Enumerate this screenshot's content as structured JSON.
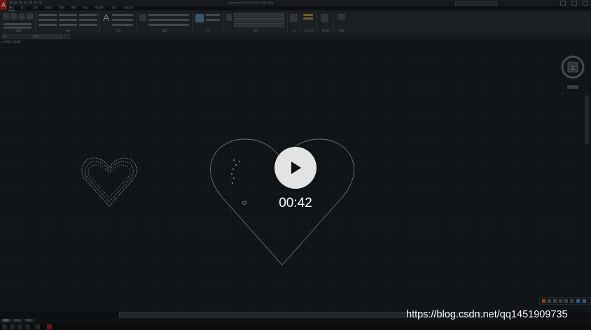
{
  "app": {
    "logo_letter": "A",
    "title": "Autodesk AutoCAD 2019  心形1.dwg"
  },
  "menu_tabs": [
    "默认",
    "插入",
    "注释",
    "参数化",
    "视图",
    "管理",
    "输出",
    "附加模块",
    "协作",
    "精选应用"
  ],
  "ribbon": {
    "groups": [
      "绘图",
      "修改",
      "注释",
      "图层",
      "块",
      "特性",
      "组",
      "实用工具",
      "剪贴板",
      "视图"
    ]
  },
  "file_tabs": [
    "开始",
    "心形1*"
  ],
  "viewport_label": "[-][俯视][二维线框]",
  "viewcube_label": "上",
  "layout_tabs": [
    "模型",
    "布局1",
    "布局2"
  ],
  "video": {
    "duration": "00:42",
    "play_icon": "play-icon"
  },
  "watermark": "https://blog.csdn.net/qq1451909735",
  "colors": {
    "canvas": "#151a1e",
    "ribbon": "#24282c",
    "heart_line": "#8c9298",
    "play_bg": "#e3e3e3",
    "play_icon": "#111111"
  }
}
